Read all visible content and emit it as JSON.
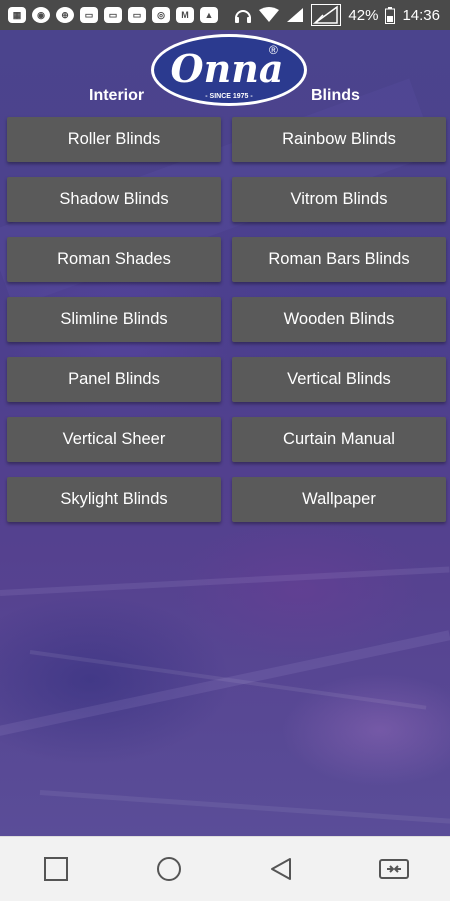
{
  "status_bar": {
    "battery": "42%",
    "time": "14:36"
  },
  "header": {
    "brand_text": "Onna",
    "brand_registered": "®",
    "brand_tagline": "- SINCE 1975 -",
    "left_label": "Interior",
    "right_label": "Blinds"
  },
  "menu": {
    "items": [
      {
        "label": "Roller Blinds"
      },
      {
        "label": "Rainbow Blinds"
      },
      {
        "label": "Shadow Blinds"
      },
      {
        "label": "Vitrom Blinds"
      },
      {
        "label": "Roman Shades"
      },
      {
        "label": "Roman Bars Blinds"
      },
      {
        "label": "Slimline Blinds"
      },
      {
        "label": "Wooden Blinds"
      },
      {
        "label": "Panel Blinds"
      },
      {
        "label": "Vertical Blinds"
      },
      {
        "label": "Vertical Sheer"
      },
      {
        "label": "Curtain Manual"
      },
      {
        "label": "Skylight Blinds"
      },
      {
        "label": "Wallpaper"
      }
    ]
  },
  "navbar": {
    "icons": [
      "recents-square-icon",
      "home-circle-icon",
      "back-triangle-icon",
      "screen-switch-icon"
    ]
  },
  "colors": {
    "button_bg": "#5a5a5a",
    "logo_bg": "#2b3a8f",
    "statusbar_bg": "#4a4a4a",
    "navbar_bg": "#f2f2f2"
  }
}
